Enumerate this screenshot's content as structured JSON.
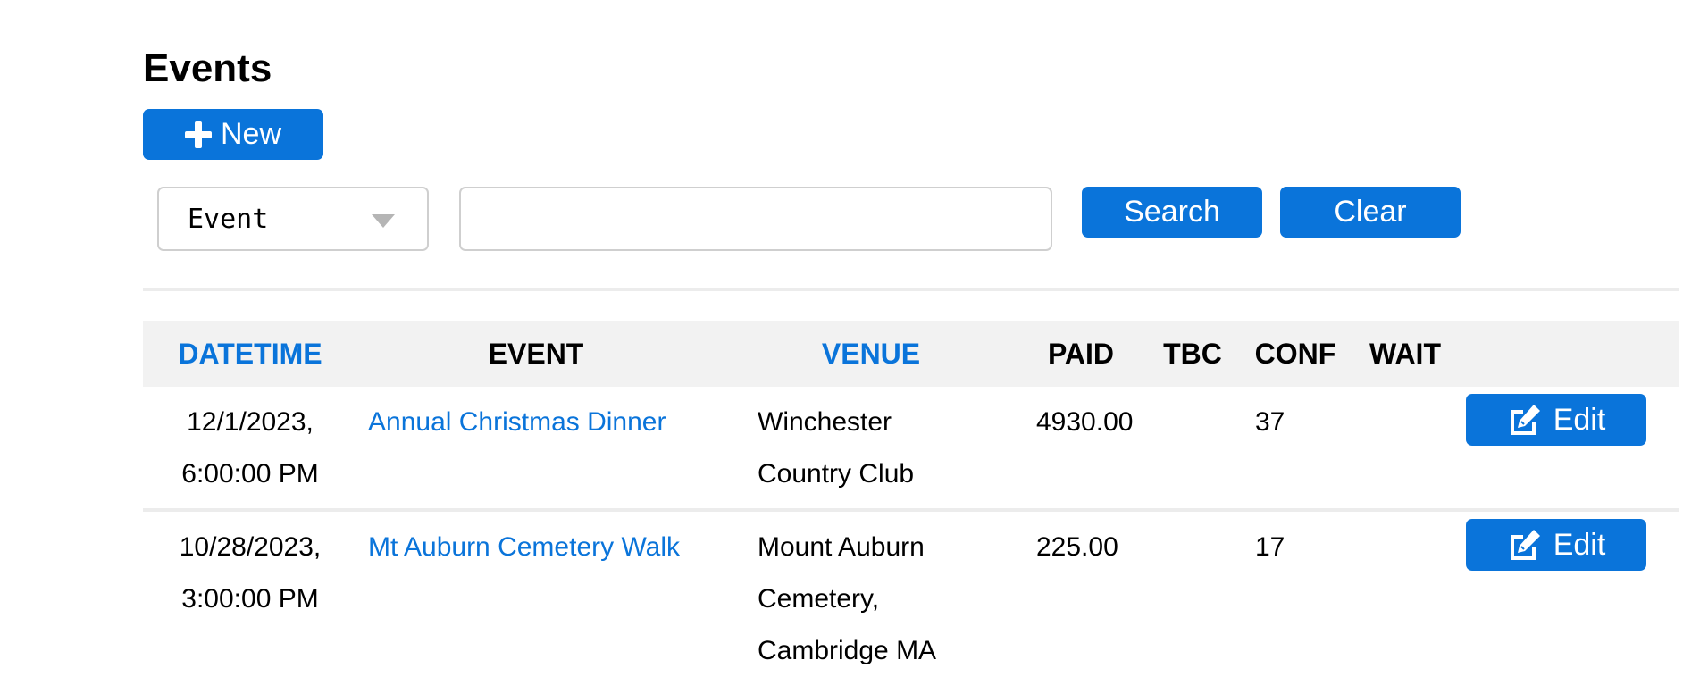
{
  "page": {
    "title": "Events"
  },
  "toolbar": {
    "new_label": "New"
  },
  "filter": {
    "field_options_selected": "Event",
    "query_value": "",
    "query_placeholder": "",
    "search_label": "Search",
    "clear_label": "Clear"
  },
  "table": {
    "columns": [
      {
        "label": "DATETIME",
        "sortable": true
      },
      {
        "label": "EVENT",
        "sortable": false
      },
      {
        "label": "VENUE",
        "sortable": true
      },
      {
        "label": "PAID",
        "sortable": false
      },
      {
        "label": "TBC",
        "sortable": false
      },
      {
        "label": "CONF",
        "sortable": false
      },
      {
        "label": "WAIT",
        "sortable": false
      }
    ],
    "rows": [
      {
        "date": "12/1/2023,",
        "time": "6:00:00 PM",
        "event": "Annual Christmas Dinner",
        "venue_lines": [
          "Winchester",
          "Country Club"
        ],
        "paid": "4930.00",
        "tbc": "",
        "conf": "37",
        "wait": "",
        "edit_label": "Edit"
      },
      {
        "date": "10/28/2023,",
        "time": "3:00:00 PM",
        "event": "Mt Auburn Cemetery Walk",
        "venue_lines": [
          "Mount Auburn",
          "Cemetery,",
          "Cambridge MA"
        ],
        "paid": "225.00",
        "tbc": "",
        "conf": "17",
        "wait": "",
        "edit_label": "Edit"
      }
    ]
  },
  "icons": {
    "new": "plus-icon",
    "select": "caret-down-icon",
    "edit": "edit-square-pencil-icon"
  },
  "colors": {
    "primary": "#0a74da",
    "header_bg": "#f2f2f2",
    "divider": "#ececec"
  }
}
